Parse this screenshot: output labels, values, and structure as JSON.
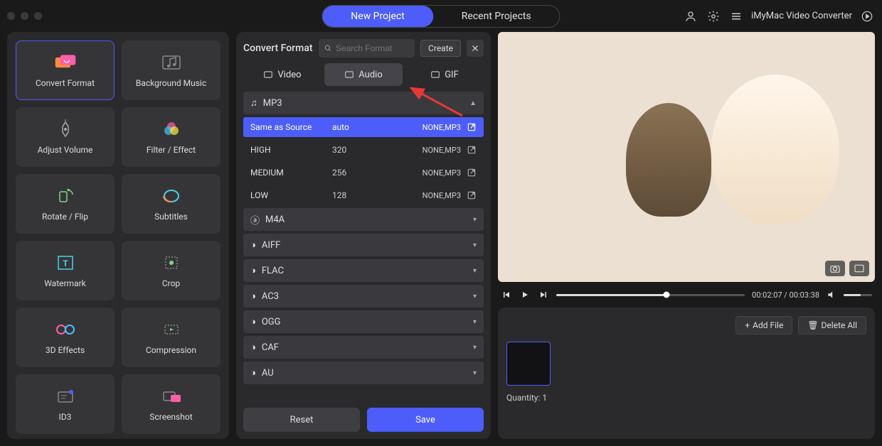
{
  "app_title": "iMyMac Video Converter",
  "top_tabs": {
    "new": "New Project",
    "recent": "Recent Projects"
  },
  "tools": [
    {
      "id": "convert-format",
      "label": "Convert Format"
    },
    {
      "id": "background-music",
      "label": "Background Music"
    },
    {
      "id": "adjust-volume",
      "label": "Adjust Volume"
    },
    {
      "id": "filter-effect",
      "label": "Filter / Effect"
    },
    {
      "id": "rotate-flip",
      "label": "Rotate / Flip"
    },
    {
      "id": "subtitles",
      "label": "Subtitles"
    },
    {
      "id": "watermark",
      "label": "Watermark"
    },
    {
      "id": "crop",
      "label": "Crop"
    },
    {
      "id": "3d-effects",
      "label": "3D Effects"
    },
    {
      "id": "compression",
      "label": "Compression"
    },
    {
      "id": "id3",
      "label": "ID3"
    },
    {
      "id": "screenshot",
      "label": "Screenshot"
    }
  ],
  "center": {
    "title": "Convert Format",
    "search_placeholder": "Search Format",
    "create_label": "Create",
    "tabs": {
      "video": "Video",
      "audio": "Audio",
      "gif": "GIF"
    }
  },
  "formats": {
    "expanded": "MP3",
    "presets": [
      {
        "name": "Same as Source",
        "bitrate": "auto",
        "codec": "NONE,MP3"
      },
      {
        "name": "HIGH",
        "bitrate": "320",
        "codec": "NONE,MP3"
      },
      {
        "name": "MEDIUM",
        "bitrate": "256",
        "codec": "NONE,MP3"
      },
      {
        "name": "LOW",
        "bitrate": "128",
        "codec": "NONE,MP3"
      }
    ],
    "collapsed": [
      "M4A",
      "AIFF",
      "FLAC",
      "AC3",
      "OGG",
      "CAF",
      "AU"
    ]
  },
  "actions": {
    "reset": "Reset",
    "save": "Save"
  },
  "playback": {
    "current": "00:02:07",
    "total": "00:03:38",
    "separator": " / ",
    "progress_pct": 58.4,
    "volume_pct": 60
  },
  "files": {
    "add_label": "Add File",
    "delete_label": "Delete All",
    "quantity_label": "Quantity: ",
    "quantity_value": "1"
  },
  "icons": {
    "music": "♫",
    "plus": "+",
    "trash": "⌫"
  }
}
